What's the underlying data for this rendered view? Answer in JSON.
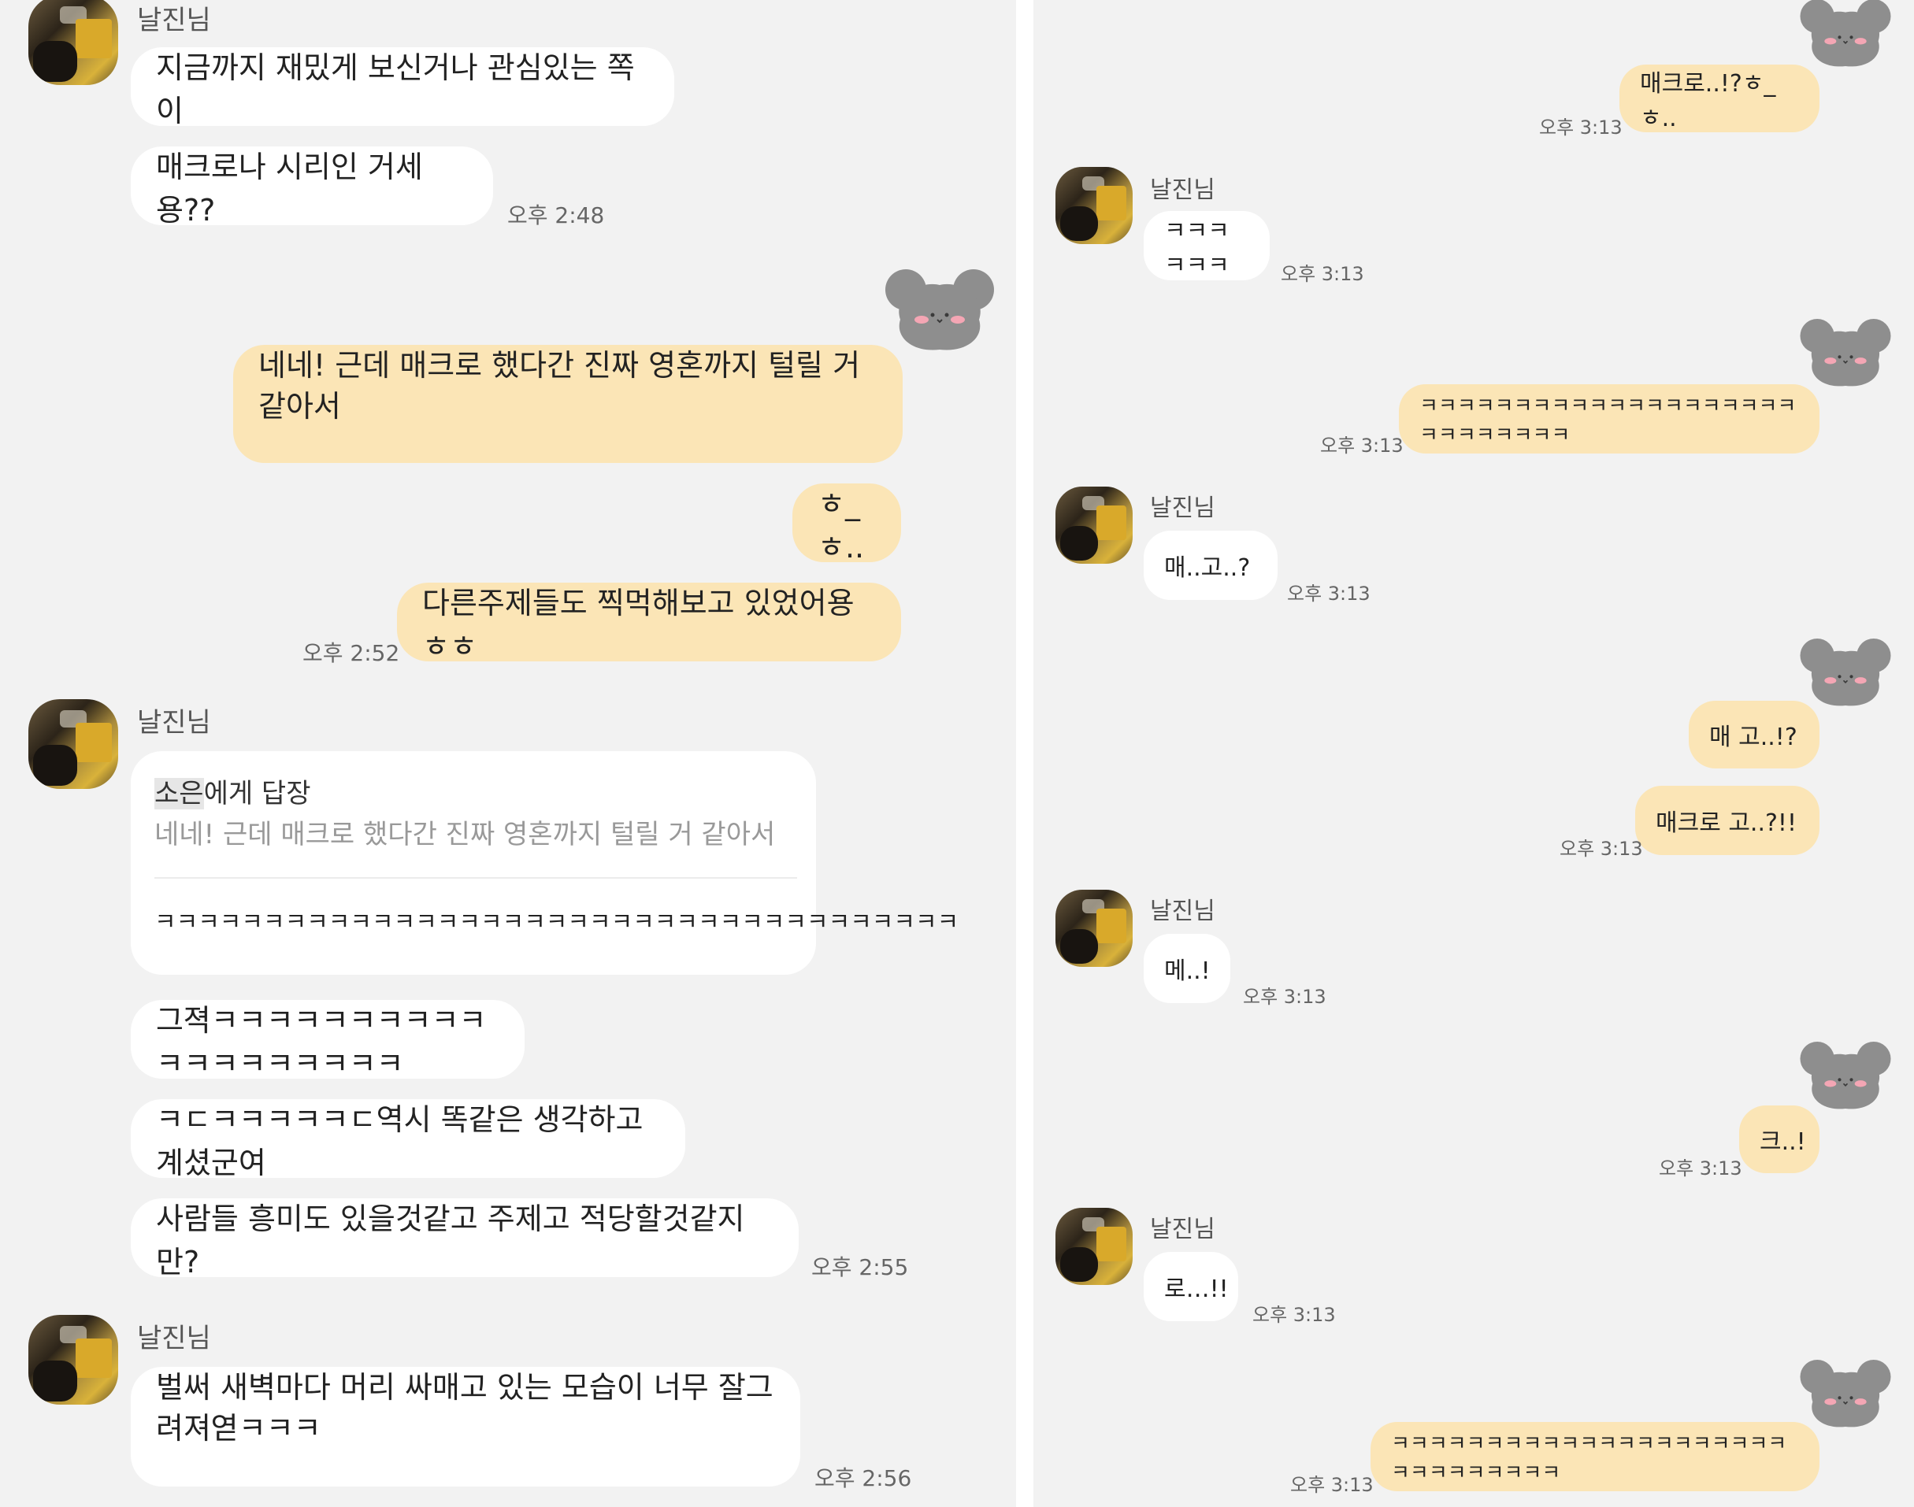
{
  "left": {
    "groups": [
      {
        "sender": "날진님",
        "messages": [
          {
            "text": "지금까지 재밌게 보신거나 관심있는 쪽이"
          },
          {
            "text": "매크로나 시리인 거세용??",
            "time": "오후 2:48"
          }
        ]
      },
      {
        "sender": "me",
        "messages": [
          {
            "text": "네네! 근데 매크로 했다간 진짜 영혼까지 털릴 거 같아서"
          },
          {
            "text": "ㅎ_ㅎ.."
          },
          {
            "text": "다른주제들도 찍먹해보고 있었어용ㅎㅎ",
            "time": "오후 2:52"
          }
        ]
      },
      {
        "sender": "날진님",
        "reply": {
          "header_name": "소은",
          "header_suffix": "에게 답장",
          "quoted": "네네! 근데 매크로 했다간 진짜 영혼까지 털릴 거 같아서",
          "body": "ㅋㅋㅋㅋㅋㅋㅋㅋㅋㅋㅋㅋㅋㅋㅋㅋㅋㅋㅋㅋㅋㅋㅋㅋㅋㅋㅋㅋㅋㅋㅋㅋㅋㅋㅋㅋㅋ"
        },
        "messages": [
          {
            "text": "그젹ㅋㅋㅋㅋㅋㅋㅋㅋㅋㅋㅋㅋㅋㅋㅋㅋㅋㅋㅋ"
          },
          {
            "text": "ㅋㄷㅋㅋㅋㅋㅋㄷ역시 똑같은 생각하고 계셨군여"
          },
          {
            "text": "사람들 흥미도 있을것같고 주제고 적당할것같지만?",
            "time": "오후 2:55"
          }
        ]
      },
      {
        "sender": "날진님",
        "messages": [
          {
            "text": "벌써 새벽마다 머리 싸매고 있는 모습이 너무 잘그려져엳ㅋㅋㅋ",
            "time": "오후 2:56"
          }
        ]
      }
    ]
  },
  "right": {
    "messages": [
      {
        "from": "me",
        "text": "매크로..!?ㅎ_ㅎ..",
        "time": "오후 3:13"
      },
      {
        "from": "날진님",
        "text": "ㅋㅋㅋㅋㅋㅋ",
        "time": "오후 3:13"
      },
      {
        "from": "me",
        "text": "ㅋㅋㅋㅋㅋㅋㅋㅋㅋㅋㅋㅋㅋㅋㅋㅋㅋㅋㅋㅋㅋㅋㅋㅋㅋㅋㅋㅋ",
        "time": "오후 3:13"
      },
      {
        "from": "날진님",
        "text": "매..고..?",
        "time": "오후 3:13"
      },
      {
        "from": "me",
        "text": "매 고..!?"
      },
      {
        "from": "me",
        "text": "매크로 고..?!!",
        "time": "오후 3:13"
      },
      {
        "from": "날진님",
        "text": "메..!",
        "time": "오후 3:13"
      },
      {
        "from": "me",
        "text": "크..!",
        "time": "오후 3:13"
      },
      {
        "from": "날진님",
        "text": "로…!!",
        "time": "오후 3:13"
      },
      {
        "from": "me",
        "text": "ㅋㅋㅋㅋㅋㅋㅋㅋㅋㅋㅋㅋㅋㅋㅋㅋㅋㅋㅋㅋㅋㅋㅋㅋㅋㅋㅋㅋㅋㅋ",
        "time": "오후 3:13"
      }
    ]
  },
  "colors": {
    "background": "#f2f2f2",
    "incoming_bubble": "#ffffff",
    "outgoing_bubble": "#fbe5b6",
    "bear": "#8e8e8e"
  }
}
